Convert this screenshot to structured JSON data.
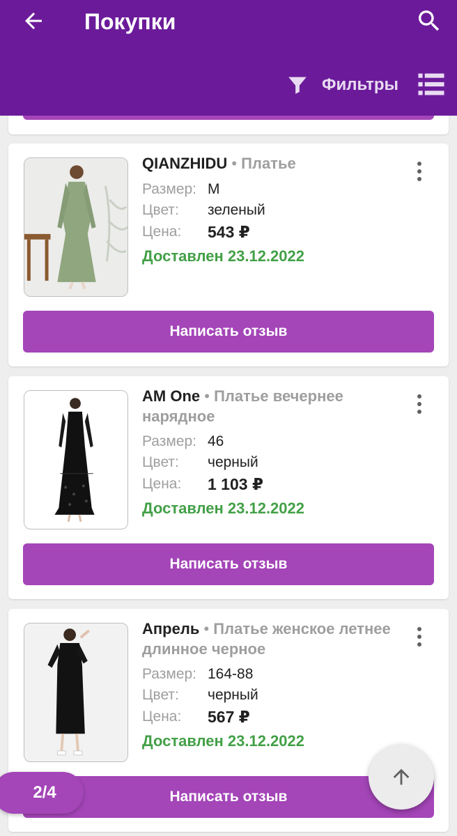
{
  "header": {
    "title": "Покупки",
    "filter_label": "Фильтры",
    "accent_color": "#6b1b9a"
  },
  "labels": {
    "size": "Размер:",
    "color": "Цвет:",
    "price": "Цена:",
    "review_button": "Написать отзыв"
  },
  "purchases": [
    {
      "brand": "QIANZHIDU",
      "type": "Платье",
      "size": "M",
      "color": "зеленый",
      "price": "543 ₽",
      "status": "Доставлен 23.12.2022"
    },
    {
      "brand": "AM One",
      "type": "Платье вечернее нарядное",
      "size": "46",
      "color": "черный",
      "price": "1 103 ₽",
      "status": "Доставлен 23.12.2022"
    },
    {
      "brand": "Апрель",
      "type": "Платье женское летнее длинное черное",
      "size": "164-88",
      "color": "черный",
      "price": "567 ₽",
      "status": "Доставлен 23.12.2022"
    }
  ],
  "pager": "2/4",
  "icons": [
    "arrow-left-icon",
    "search-icon",
    "filter-icon",
    "list-view-icon",
    "more-vert-icon",
    "arrow-up-icon"
  ]
}
